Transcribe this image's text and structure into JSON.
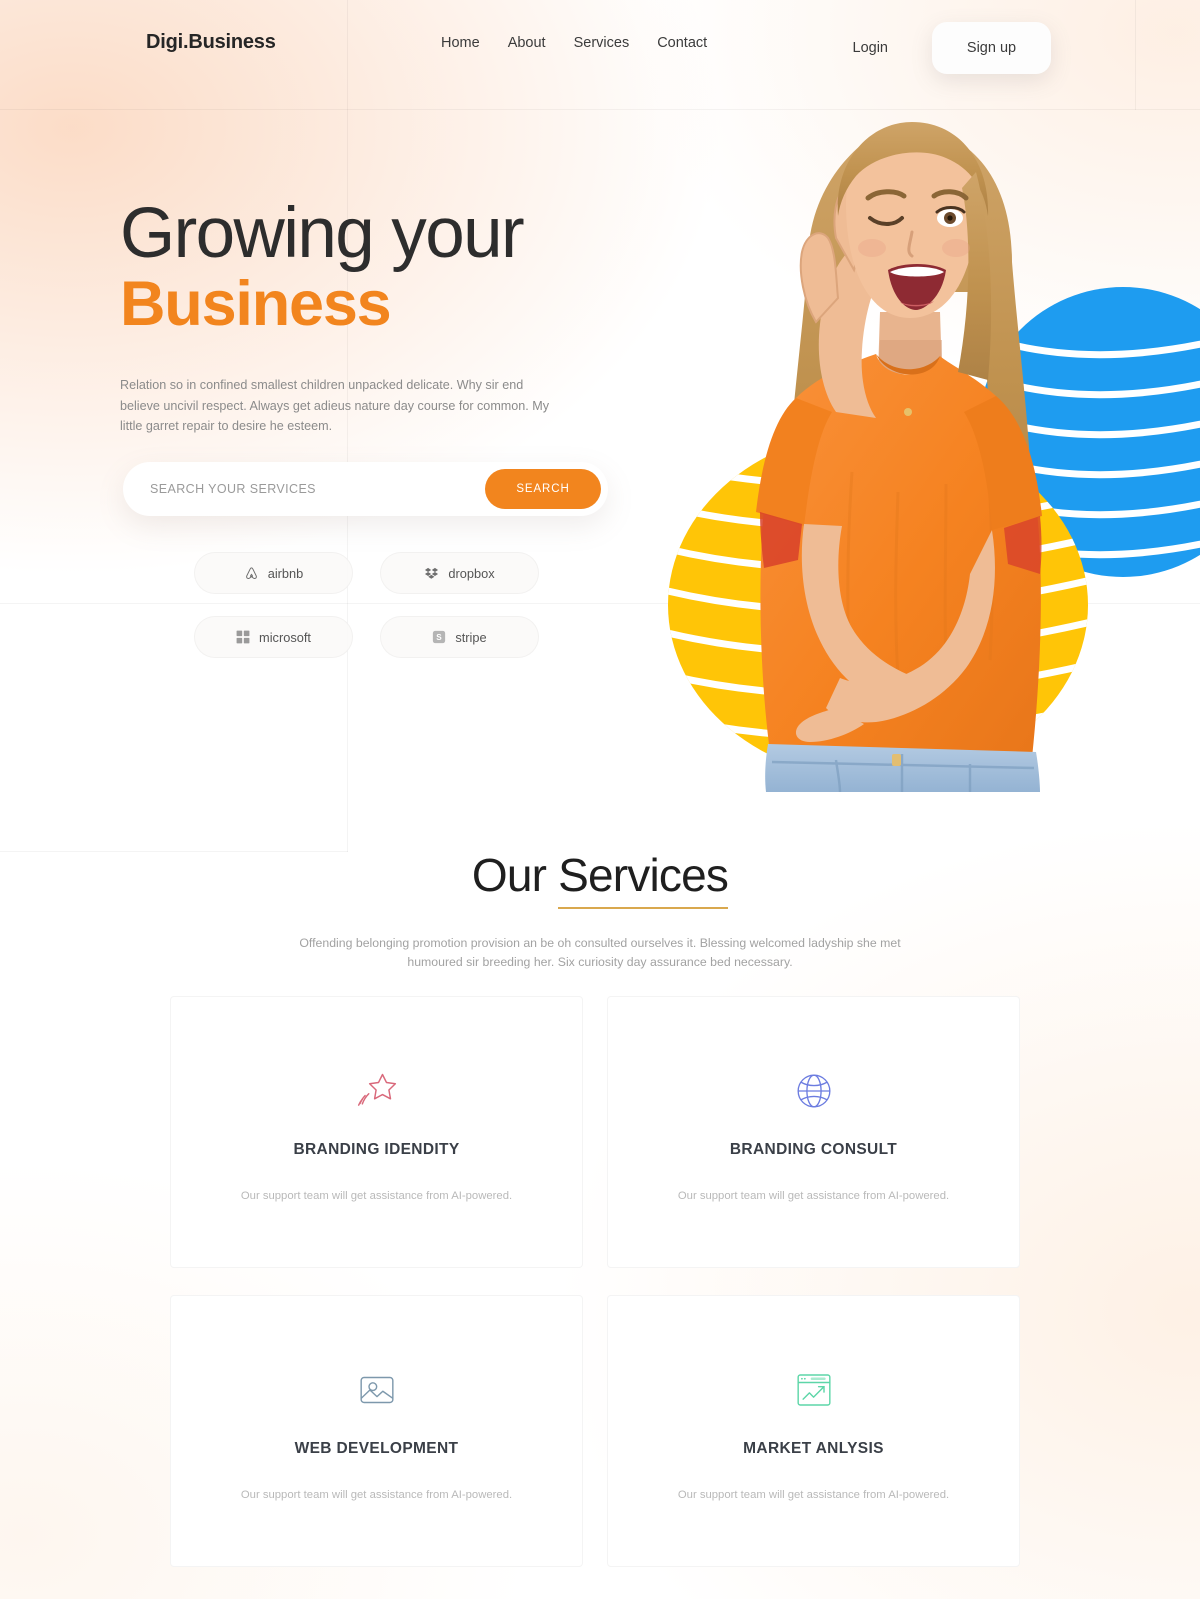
{
  "header": {
    "logo": "Digi.Business",
    "nav": [
      {
        "label": "Home"
      },
      {
        "label": "About"
      },
      {
        "label": "Services"
      },
      {
        "label": "Contact"
      }
    ],
    "login_label": "Login",
    "signup_label": "Sign up"
  },
  "hero": {
    "title_line1": "Growing your",
    "title_line2": "Business",
    "description": "Relation so in confined smallest children unpacked delicate. Why sir end believe uncivil respect. Always get adieus nature day course for common. My little garret repair to desire he esteem.",
    "search_placeholder": "SEARCH YOUR SERVICES",
    "search_value": "",
    "search_button": "SEARCH",
    "brands": [
      {
        "name": "airbnb",
        "icon": "airbnb-icon"
      },
      {
        "name": "dropbox",
        "icon": "dropbox-icon"
      },
      {
        "name": "microsoft",
        "icon": "microsoft-icon"
      },
      {
        "name": "stripe",
        "icon": "stripe-icon"
      }
    ]
  },
  "services": {
    "title_plain": "Our ",
    "title_underlined": "Services",
    "subtitle": "Offending belonging promotion provision an be oh consulted ourselves it. Blessing welcomed ladyship she met humoured sir breeding her. Six curiosity day assurance bed necessary.",
    "cards": [
      {
        "title": "BRANDING IDENDITY",
        "description": "Our support team will get assistance from AI-powered.",
        "icon": "shooting-star-icon",
        "icon_color": "#D9697B"
      },
      {
        "title": "BRANDING CONSULT",
        "description": "Our support team will get assistance from AI-powered.",
        "icon": "globe-icon",
        "icon_color": "#6C7CE0"
      },
      {
        "title": "WEB DEVELOPMENT",
        "description": "Our support team will get assistance from AI-powered.",
        "icon": "image-icon",
        "icon_color": "#7D98AC"
      },
      {
        "title": "MARKET ANLYSIS",
        "description": "Our support team will get assistance from AI-powered.",
        "icon": "market-chart-icon",
        "icon_color": "#5DD6A8"
      }
    ]
  },
  "colors": {
    "accent_orange": "#F2851E",
    "blue_blob": "#1E9CF0",
    "yellow_blob": "#FFC507",
    "underline_gold": "#D9A84E",
    "heading_dark": "#2D2D2D"
  },
  "hero_image": {
    "alt": "smiling woman in orange t-shirt making ok gesture",
    "shirt_color": "#F58220",
    "jeans_color": "#A9C4DE",
    "hair_color": "#C69A5F"
  }
}
